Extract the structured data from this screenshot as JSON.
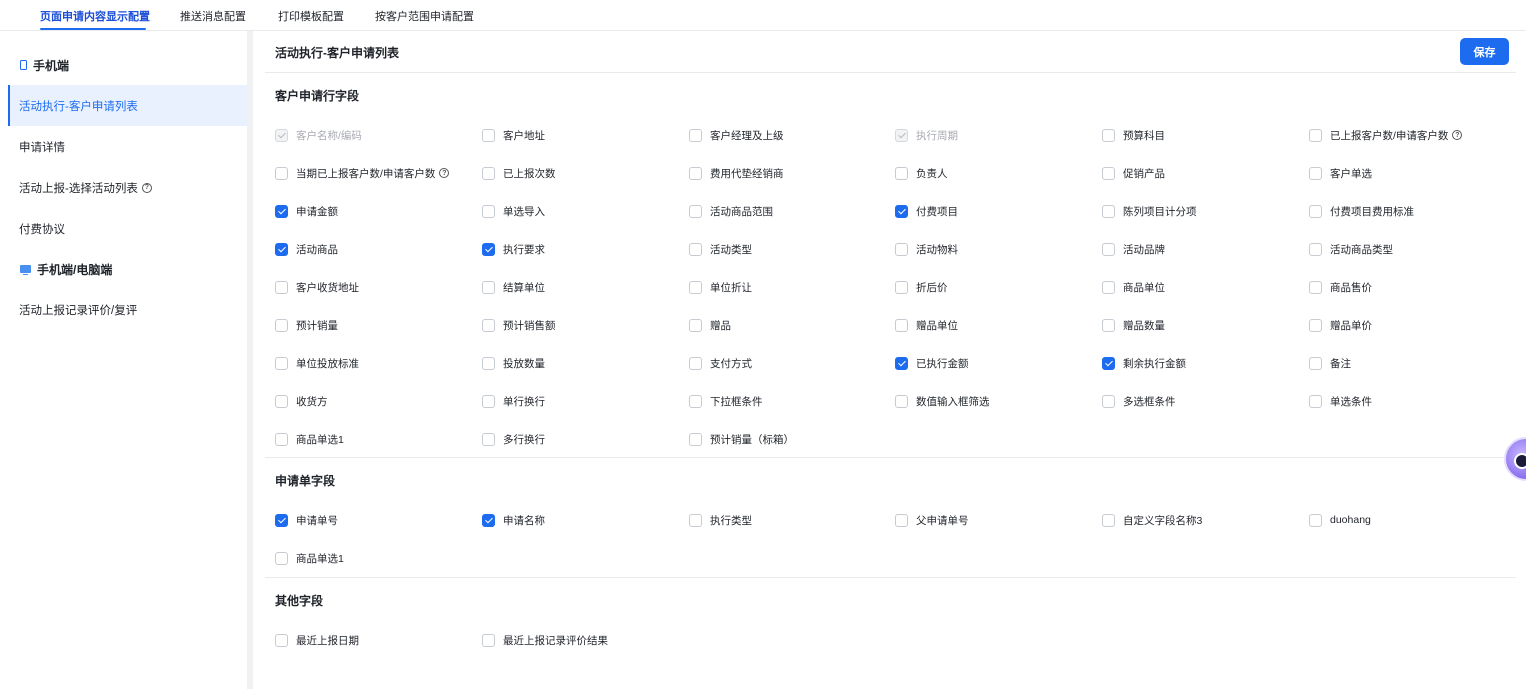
{
  "tabs": [
    {
      "label": "页面申请内容显示配置",
      "active": true
    },
    {
      "label": "推送消息配置",
      "active": false
    },
    {
      "label": "打印模板配置",
      "active": false
    },
    {
      "label": "按客户范围申请配置",
      "active": false
    }
  ],
  "sidebar": {
    "groups": [
      {
        "label": "手机端",
        "icon": "mobile-phone-icon"
      },
      {
        "label": "手机端/电脑端",
        "icon": "desktop-icon"
      }
    ],
    "items": [
      {
        "label": "活动执行-客户申请列表",
        "active": true
      },
      {
        "label": "申请详情",
        "active": false
      },
      {
        "label": "活动上报-选择活动列表",
        "help": "?",
        "active": false
      },
      {
        "label": "付费协议",
        "active": false
      },
      {
        "label": "活动上报记录评价/复评",
        "active": false
      }
    ]
  },
  "main": {
    "title": "活动执行-客户申请列表",
    "save_label": "保存",
    "accent_color": "#1d6cf0"
  },
  "sections": [
    {
      "title": "客户申请行字段",
      "fields": [
        {
          "label": "客户名称/编码",
          "state": "disabled"
        },
        {
          "label": "客户地址",
          "state": "unchecked"
        },
        {
          "label": "客户经理及上级",
          "state": "unchecked"
        },
        {
          "label": "执行周期",
          "state": "disabled"
        },
        {
          "label": "预算科目",
          "state": "unchecked"
        },
        {
          "label": "已上报客户数/申请客户数",
          "state": "unchecked",
          "help": "?"
        },
        {
          "label": "当期已上报客户数/申请客户数",
          "state": "unchecked",
          "help": "?"
        },
        {
          "label": "已上报次数",
          "state": "unchecked"
        },
        {
          "label": "费用代垫经销商",
          "state": "unchecked"
        },
        {
          "label": "负责人",
          "state": "unchecked"
        },
        {
          "label": "促销产品",
          "state": "unchecked"
        },
        {
          "label": "客户单选",
          "state": "unchecked"
        },
        {
          "label": "申请金额",
          "state": "checked"
        },
        {
          "label": "单选导入",
          "state": "unchecked"
        },
        {
          "label": "活动商品范围",
          "state": "unchecked"
        },
        {
          "label": "付费项目",
          "state": "checked"
        },
        {
          "label": "陈列项目计分项",
          "state": "unchecked"
        },
        {
          "label": "付费项目费用标准",
          "state": "unchecked"
        },
        {
          "label": "活动商品",
          "state": "checked"
        },
        {
          "label": "执行要求",
          "state": "checked"
        },
        {
          "label": "活动类型",
          "state": "unchecked"
        },
        {
          "label": "活动物料",
          "state": "unchecked"
        },
        {
          "label": "活动品牌",
          "state": "unchecked"
        },
        {
          "label": "活动商品类型",
          "state": "unchecked"
        },
        {
          "label": "客户收货地址",
          "state": "unchecked"
        },
        {
          "label": "结算单位",
          "state": "unchecked"
        },
        {
          "label": "单位折让",
          "state": "unchecked"
        },
        {
          "label": "折后价",
          "state": "unchecked"
        },
        {
          "label": "商品单位",
          "state": "unchecked"
        },
        {
          "label": "商品售价",
          "state": "unchecked"
        },
        {
          "label": "预计销量",
          "state": "unchecked"
        },
        {
          "label": "预计销售额",
          "state": "unchecked"
        },
        {
          "label": "赠品",
          "state": "unchecked"
        },
        {
          "label": "赠品单位",
          "state": "unchecked"
        },
        {
          "label": "赠品数量",
          "state": "unchecked"
        },
        {
          "label": "赠品单价",
          "state": "unchecked"
        },
        {
          "label": "单位投放标准",
          "state": "unchecked"
        },
        {
          "label": "投放数量",
          "state": "unchecked"
        },
        {
          "label": "支付方式",
          "state": "unchecked"
        },
        {
          "label": "已执行金额",
          "state": "checked"
        },
        {
          "label": "剩余执行金额",
          "state": "checked"
        },
        {
          "label": "备注",
          "state": "unchecked"
        },
        {
          "label": "收货方",
          "state": "unchecked"
        },
        {
          "label": "单行换行",
          "state": "unchecked"
        },
        {
          "label": "下拉框条件",
          "state": "unchecked"
        },
        {
          "label": "数值输入框筛选",
          "state": "unchecked"
        },
        {
          "label": "多选框条件",
          "state": "unchecked"
        },
        {
          "label": "单选条件",
          "state": "unchecked"
        },
        {
          "label": "商品单选1",
          "state": "unchecked"
        },
        {
          "label": "多行换行",
          "state": "unchecked"
        },
        {
          "label": "预计销量（标箱）",
          "state": "unchecked"
        }
      ]
    },
    {
      "title": "申请单字段",
      "fields": [
        {
          "label": "申请单号",
          "state": "checked"
        },
        {
          "label": "申请名称",
          "state": "checked"
        },
        {
          "label": "执行类型",
          "state": "unchecked"
        },
        {
          "label": "父申请单号",
          "state": "unchecked"
        },
        {
          "label": "自定义字段名称3",
          "state": "unchecked"
        },
        {
          "label": "duohang",
          "state": "unchecked"
        },
        {
          "label": "商品单选1",
          "state": "unchecked"
        }
      ]
    },
    {
      "title": "其他字段",
      "fields": [
        {
          "label": "最近上报日期",
          "state": "unchecked"
        },
        {
          "label": "最近上报记录评价结果",
          "state": "unchecked"
        }
      ]
    }
  ]
}
